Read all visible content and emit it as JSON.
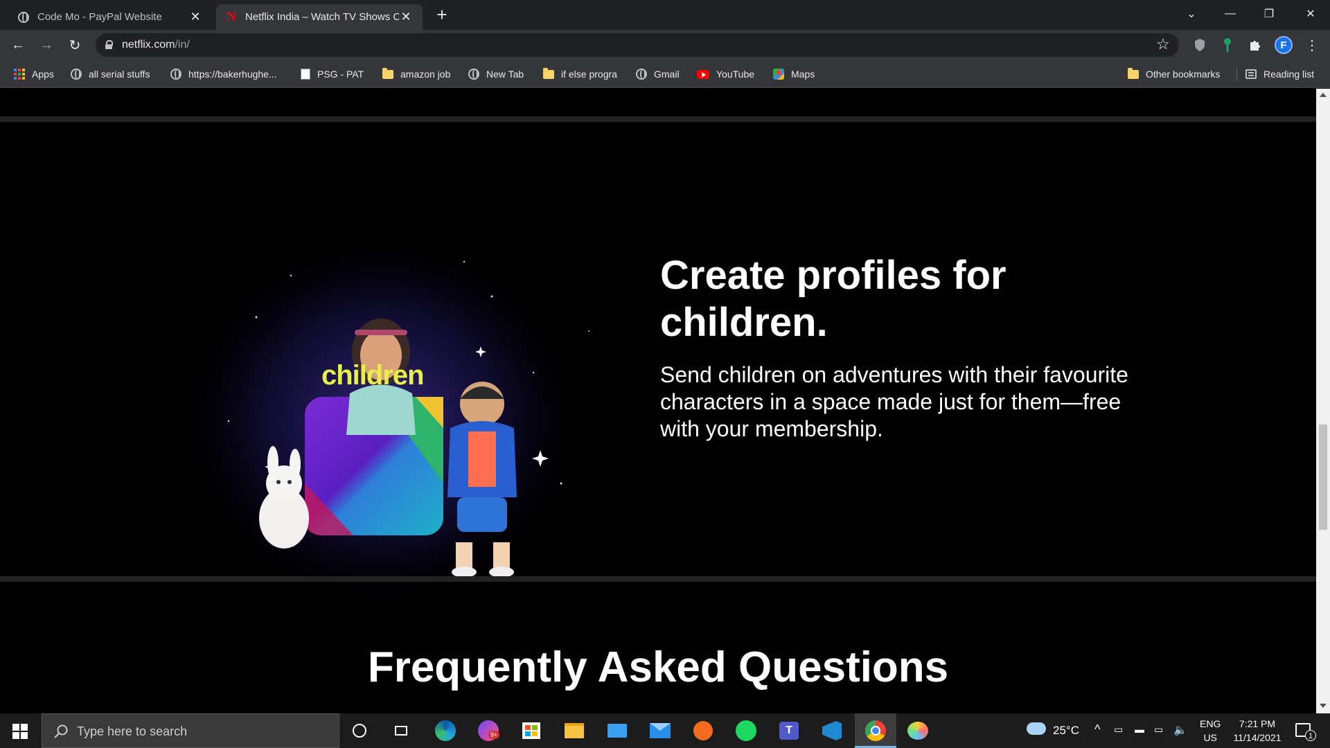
{
  "browser": {
    "tabs": [
      {
        "title": "Code Mo - PayPal Website",
        "active": false
      },
      {
        "title": "Netflix India – Watch TV Shows Online",
        "active": true
      }
    ],
    "new_tab_glyph": "+",
    "window_controls": {
      "tab_search": "⌄",
      "minimize": "—",
      "restore": "❐",
      "close": "✕"
    },
    "nav": {
      "back": "←",
      "forward": "→",
      "reload": "↻"
    },
    "url_host": "netflix.com",
    "url_path": "/in/",
    "star": "☆",
    "profile_initial": "F",
    "menu_glyph": "⋮"
  },
  "bookmarks": [
    {
      "label": "Apps",
      "icon": "apps-grid-icon"
    },
    {
      "label": "all serial stuffs",
      "icon": "globe-icon"
    },
    {
      "label": "https://bakerhughe...",
      "icon": "globe-icon"
    },
    {
      "label": "PSG - PAT",
      "icon": "document-icon"
    },
    {
      "label": "amazon job",
      "icon": "folder-icon"
    },
    {
      "label": "New Tab",
      "icon": "globe-icon"
    },
    {
      "label": "if else progra",
      "icon": "folder-icon"
    },
    {
      "label": "Gmail",
      "icon": "globe-icon"
    },
    {
      "label": "YouTube",
      "icon": "youtube-icon"
    },
    {
      "label": "Maps",
      "icon": "maps-icon"
    }
  ],
  "bookmarks_right": {
    "other": "Other bookmarks",
    "reading_list": "Reading list"
  },
  "page": {
    "feature_heading": "Create profiles for children.",
    "feature_text": "Send children on adventures with their favourite characters in a space made just for them—free with your membership.",
    "children_badge": "children",
    "faq_heading": "Frequently Asked Questions"
  },
  "taskbar": {
    "search_placeholder": "Type here to search",
    "weather": "25°C",
    "lang_top": "ENG",
    "lang_bottom": "US",
    "time": "7:21 PM",
    "date": "11/14/2021",
    "notification_count": "1",
    "badge_count": "9+"
  },
  "colors": {
    "netflix_red": "#e50914",
    "chrome_dark": "#202124",
    "toolbar": "#35363a",
    "taskbar": "#1c1c1c"
  }
}
